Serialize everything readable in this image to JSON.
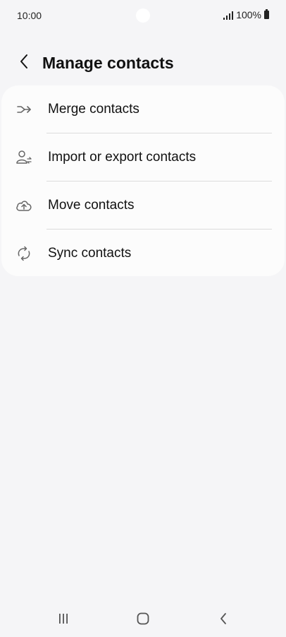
{
  "status_bar": {
    "time": "10:00",
    "battery": "100%"
  },
  "header": {
    "title": "Manage contacts",
    "back_icon": "chevron-left-icon"
  },
  "menu": {
    "items": [
      {
        "label": "Merge contacts",
        "icon": "merge-icon"
      },
      {
        "label": "Import or export contacts",
        "icon": "person-transfer-icon"
      },
      {
        "label": "Move contacts",
        "icon": "cloud-upload-icon"
      },
      {
        "label": "Sync contacts",
        "icon": "sync-icon"
      }
    ]
  },
  "navigation": {
    "recents_icon": "recents-icon",
    "home_icon": "home-icon",
    "back_icon": "back-icon"
  },
  "colors": {
    "background": "#f5f5f7",
    "card": "#fcfcfc",
    "text": "#111111",
    "icon": "#666666",
    "divider": "#dcdcdc"
  }
}
